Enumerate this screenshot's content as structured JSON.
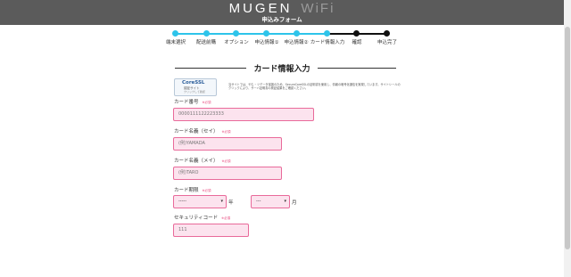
{
  "header": {
    "brand": "MUGEN",
    "brand_suffix": "WiFi",
    "subtitle": "申込みフォーム"
  },
  "steps": [
    {
      "label": "端末選択",
      "state": "done"
    },
    {
      "label": "配送前購",
      "state": "done"
    },
    {
      "label": "オプション",
      "state": "done"
    },
    {
      "label": "申込情報①",
      "state": "done"
    },
    {
      "label": "申込情報②",
      "state": "done"
    },
    {
      "label": "カード情報入力",
      "state": "current"
    },
    {
      "label": "確認",
      "state": "todo"
    },
    {
      "label": "申込完了",
      "state": "todo"
    }
  ],
  "section_title": "カード情報入力",
  "security_badge": {
    "title": "CoreSSL",
    "subtitle": "認証サイト",
    "caption": "クリックして確認"
  },
  "notice": "当サイトでは、やむ・ツデータ保護のため、SecureCoreSSLの証明書を使用し、情報の暗号化通信を実現しています。サイトシールのクリックにより、サーバ証明書の検証結果をご確認ください。",
  "form": {
    "required_label": "※必須",
    "card_number": {
      "label": "カード番号",
      "value": "0000111122223333"
    },
    "name_sei": {
      "label": "カード名義（セイ）",
      "placeholder": "(例)YAMADA"
    },
    "name_mei": {
      "label": "カード名義（メイ）",
      "placeholder": "(例)TARO"
    },
    "expiry": {
      "label": "カード期限",
      "year_value": "-----",
      "year_unit": "年",
      "month_value": "---",
      "month_unit": "月"
    },
    "security_code": {
      "label": "セキュリティコード",
      "placeholder": "111"
    }
  },
  "colors": {
    "header_bg": "#5b5b5b",
    "step_done": "#2ec4ea",
    "step_todo": "#111111",
    "field_bg": "#fce3ee",
    "field_border": "#e96a9a",
    "required": "#e84a7f"
  }
}
